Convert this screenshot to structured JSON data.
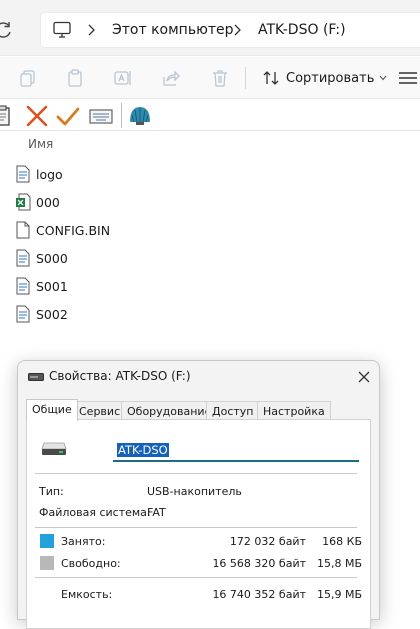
{
  "address_bar": {
    "breadcrumbs": [
      {
        "label": "Этот компьютер"
      },
      {
        "label": "ATK-DSO (F:)"
      }
    ]
  },
  "command_bar": {
    "sort_label": "Сортировать",
    "icons": [
      "copy-icon",
      "paste-icon",
      "rename-icon",
      "share-icon",
      "delete-icon",
      "sort-icon",
      "more-icon"
    ]
  },
  "toolbar2": {
    "icons": [
      "clipboard-icon",
      "cancel-x-icon",
      "confirm-check-icon",
      "keyboard-icon",
      "shell-icon"
    ],
    "colors": {
      "cancel": "#d9531e",
      "confirm": "#d97a1e",
      "shell": "#2e8bb0"
    }
  },
  "file_list": {
    "column_header": "Имя",
    "items": [
      {
        "name": "logo",
        "icon": "text-file-icon"
      },
      {
        "name": "000",
        "icon": "excel-file-icon"
      },
      {
        "name": "CONFIG.BIN",
        "icon": "file-icon"
      },
      {
        "name": "S000",
        "icon": "text-file-icon"
      },
      {
        "name": "S001",
        "icon": "text-file-icon"
      },
      {
        "name": "S002",
        "icon": "text-file-icon"
      }
    ]
  },
  "properties_dialog": {
    "title": "Свойства: ATK-DSO (F:)",
    "tabs": [
      {
        "label": "Общие",
        "active": true
      },
      {
        "label": "Сервис",
        "active": false
      },
      {
        "label": "Оборудование",
        "active": false
      },
      {
        "label": "Доступ",
        "active": false
      },
      {
        "label": "Настройка",
        "active": false
      }
    ],
    "volume_name": "ATK-DSO",
    "type_label": "Тип:",
    "type_value": "USB-накопитель",
    "fs_label": "Файловая система:",
    "fs_value": "FAT",
    "used": {
      "label": "Занято:",
      "bytes": "172 032 байт",
      "human": "168 КБ",
      "color": "#26a0da"
    },
    "free": {
      "label": "Свободно:",
      "bytes": "16 568 320 байт",
      "human": "15,8 МБ",
      "color": "#b8b8b8"
    },
    "capacity": {
      "label": "Емкость:",
      "bytes": "16 740 352 байт",
      "human": "15,9 МБ"
    }
  }
}
